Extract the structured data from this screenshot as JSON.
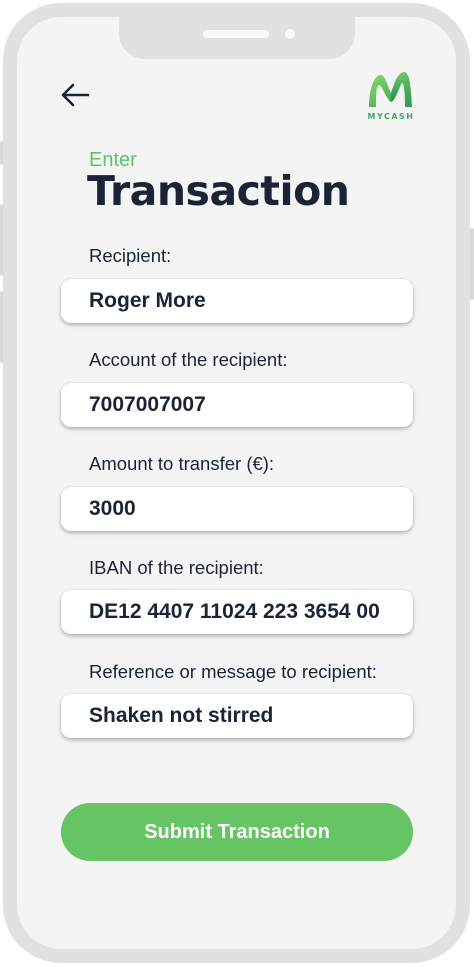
{
  "header": {
    "back_icon": "arrow-left-icon",
    "logo_icon": "mycash-logo-icon",
    "logo_text": "MYCASH"
  },
  "heading": {
    "subtitle": "Enter",
    "title": "Transaction"
  },
  "form": {
    "fields": [
      {
        "label": "Recipient:",
        "value": "Roger More"
      },
      {
        "label": "Account of the recipient:",
        "value": "7007007007"
      },
      {
        "label": "Amount to transfer (€):",
        "value": "3000"
      },
      {
        "label": "IBAN of the recipient:",
        "value": "DE12 4407 11024 223 3654 00"
      },
      {
        "label": "Reference or message to recipient:",
        "value": "Shaken not stirred"
      }
    ],
    "submit_label": "Submit Transaction"
  },
  "colors": {
    "accent_green": "#66c464",
    "text_dark": "#1b2436",
    "frame_gray": "#e1e1e1",
    "screen_bg": "#f4f4f4"
  }
}
